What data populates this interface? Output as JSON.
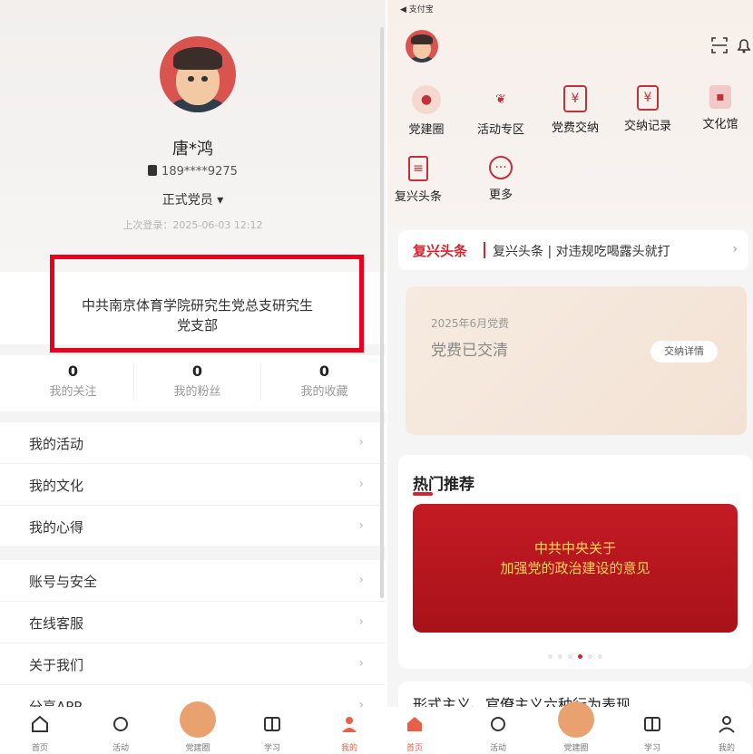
{
  "left": {
    "name": "唐*鸿",
    "phone": "189****9275",
    "role": "正式党员 ▾",
    "last_login": "上次登录：2025-06-03 12:12",
    "branch_line1": "中共南京体育学院研究生党总支研究生",
    "branch_line2": "党支部",
    "stats": [
      {
        "num": "0",
        "label": "我的关注"
      },
      {
        "num": "0",
        "label": "我的粉丝"
      },
      {
        "num": "0",
        "label": "我的收藏"
      }
    ],
    "menu1": [
      "我的活动",
      "我的文化",
      "我的心得"
    ],
    "menu2": [
      "账号与安全",
      "在线客服",
      "关于我们",
      "分享APP"
    ],
    "arrow": "›",
    "tabs": [
      "首页",
      "活动",
      "党建圈",
      "学习",
      "我的"
    ]
  },
  "right": {
    "carrier": "◀ 支付宝",
    "grid": [
      {
        "label": "党建圈",
        "icon": "speech-bubble-icon"
      },
      {
        "label": "活动专区",
        "icon": "leaf-icon"
      },
      {
        "label": "党费交纳",
        "icon": "yen-card-icon"
      },
      {
        "label": "交纳记录",
        "icon": "receipt-icon"
      },
      {
        "label": "文化馆",
        "icon": "folder-icon"
      },
      {
        "label": "复兴头条",
        "icon": "document-icon"
      },
      {
        "label": "更多",
        "icon": "more-icon"
      }
    ],
    "news_head": "复兴头条",
    "news_text": "复兴头条 | 对违规吃喝露头就打",
    "news_arrow": "›",
    "fee_month": "2025年6月党费",
    "fee_status": "党费已交清",
    "fee_button": "交纳详情",
    "hot_title": "热门推荐",
    "banner_line1": "中共中央关于",
    "banner_line2": "加强党的政治建设的意见",
    "card2_title": "形式主义、官僚主义六种行为表现",
    "tabs": [
      "首页",
      "活动",
      "党建圈",
      "学习",
      "我的"
    ]
  },
  "colors": {
    "accent": "#d5232f",
    "highlight_box": "#e8001c",
    "tab_active": "#e8604a"
  }
}
